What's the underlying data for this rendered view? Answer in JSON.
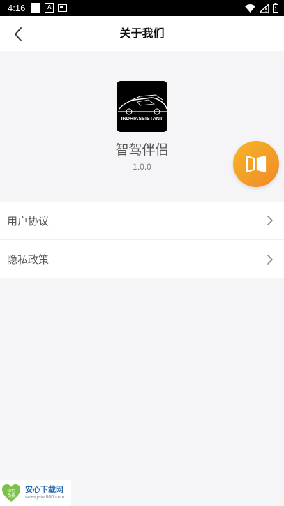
{
  "status_bar": {
    "time": "4:16",
    "a_badge": "A",
    "icons": [
      "square-icon",
      "a-notification-icon",
      "card-icon",
      "wifi-icon",
      "signal-icon",
      "battery-icon"
    ]
  },
  "header": {
    "title": "关于我们",
    "back_icon": "chevron-left-icon"
  },
  "app": {
    "logo_text": "INDRIASSISTANT",
    "name": "智驾伴侣",
    "version": "1.0.0"
  },
  "floating_button": {
    "icon": "split-door-icon",
    "colors": [
      "#f7b52a",
      "#f08a24"
    ]
  },
  "menu": {
    "items": [
      {
        "label": "用户协议",
        "icon": "chevron-right-icon"
      },
      {
        "label": "隐私政策",
        "icon": "chevron-right-icon"
      }
    ]
  },
  "watermark": {
    "badge_top": "绿色",
    "badge_bottom": "免费",
    "brand": "安心下载网",
    "url": "www.java800.com"
  },
  "colors": {
    "background": "#f5f5f7",
    "surface": "#ffffff",
    "accent_orange": "#f39a26"
  }
}
